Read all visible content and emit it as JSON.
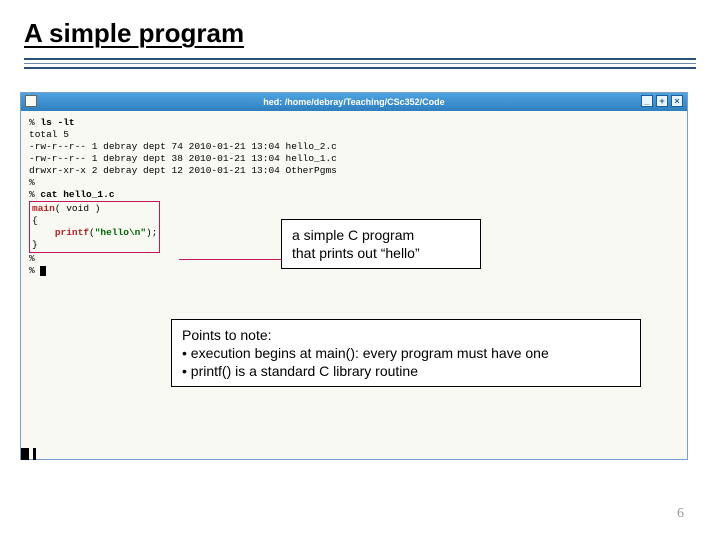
{
  "slide": {
    "title": "A simple program",
    "page_number": "6"
  },
  "window": {
    "title": "hed: /home/debray/Teaching/CSc352/Code",
    "btn_min": "_",
    "btn_max": "+",
    "btn_close": "×"
  },
  "terminal": {
    "prompt_ls": "% ",
    "cmd_ls": "ls -lt",
    "total": "total 5",
    "row1": "-rw-r--r-- 1 debray dept 74 2010-01-21 13:04 hello_2.c",
    "row2": "-rw-r--r-- 1 debray dept 38 2010-01-21 13:04 hello_1.c",
    "row3": "drwxr-xr-x 2 debray dept 12 2010-01-21 13:04 OtherPgms",
    "prompt_blank": "%",
    "prompt_cat": "% ",
    "cmd_cat": "cat hello_1.c",
    "src_main_kw": "main",
    "src_main_rest": "( void )",
    "src_lbrace": "{",
    "src_indent": "    ",
    "src_printf_kw": "printf",
    "src_printf_open": "(",
    "src_printf_str": "\"hello\\n\"",
    "src_printf_close": ");",
    "src_rbrace": "}",
    "prompt_end": "%",
    "prompt_cursor": "% "
  },
  "callout1": {
    "line1": "a simple C program",
    "line2": "that prints out “hello”"
  },
  "callout2": {
    "line1": "Points to note:",
    "line2": "• execution begins at main(): every program must have one",
    "line3": "• printf() is a standard C library routine"
  }
}
